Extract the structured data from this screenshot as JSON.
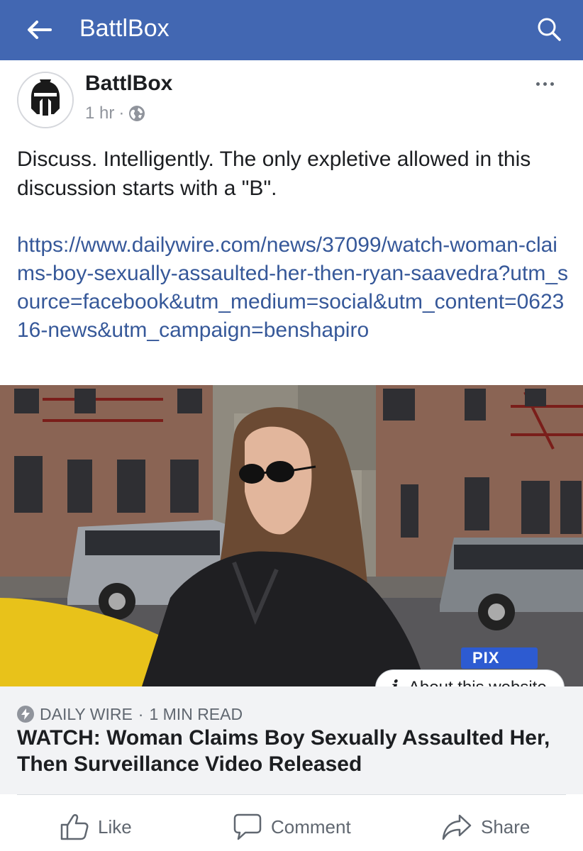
{
  "topbar": {
    "title": "BattlBox",
    "back_icon": "arrow-left-icon",
    "search_icon": "search-icon",
    "background": "#4267b2"
  },
  "post": {
    "page_name": "BattlBox",
    "time": "1 hr",
    "separator": "·",
    "privacy_icon": "globe-icon",
    "text": "Discuss. Intelligently. The only expletive allowed in this discussion starts with a \"B\".",
    "link": "https://www.dailywire.com/news/37099/watch-woman-claims-boy-sexually-assaulted-her-then-ryan-saavedra?utm_source=facebook&utm_medium=social&utm_content=062316-news&utm_campaign=benshapiro"
  },
  "preview": {
    "image_label": "PIX",
    "about_label": "About this website"
  },
  "link_card": {
    "source": "DAILY WIRE",
    "separator": "·",
    "read_time": "1 MIN READ",
    "title": "WATCH: Woman Claims Boy Sexually Assaulted Her, Then Surveillance Video Released"
  },
  "actions": {
    "like": "Like",
    "comment": "Comment",
    "share": "Share"
  }
}
